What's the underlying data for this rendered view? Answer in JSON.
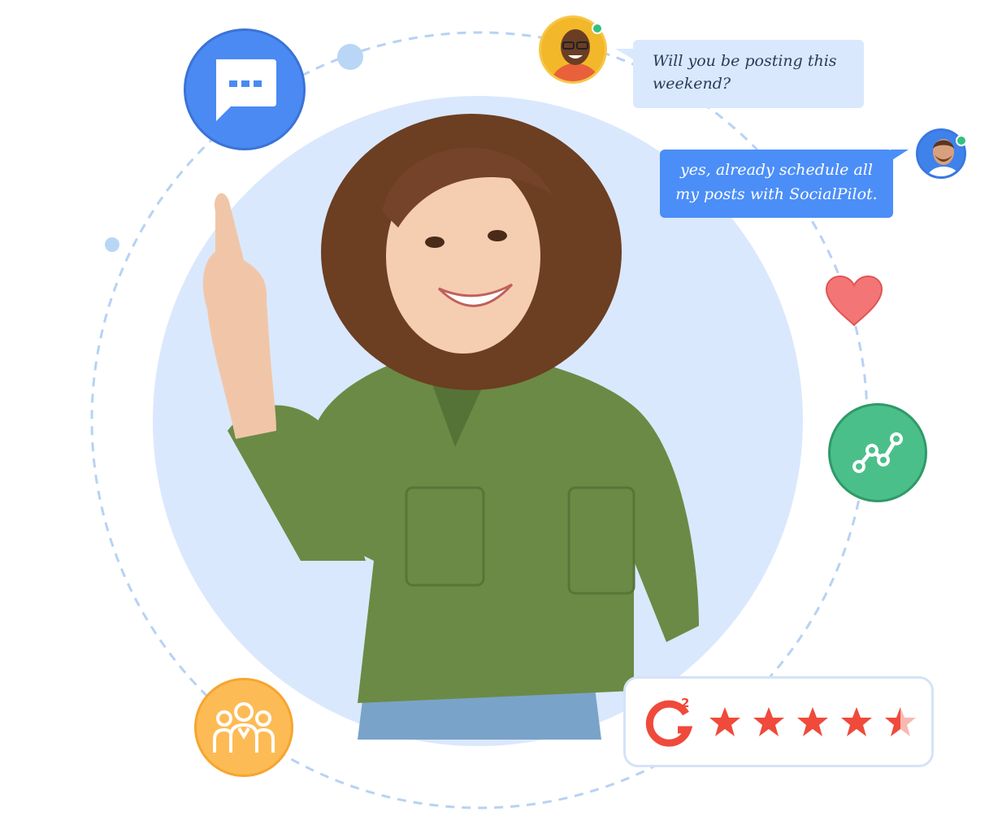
{
  "chat": {
    "question": "Will you be posting this weekend?",
    "reply": "yes, already schedule all my posts with SocialPilot."
  },
  "rating": {
    "brand": "G2",
    "stars_value": 4.5,
    "stars_max": 5,
    "star_color": "#ef4a3b"
  },
  "icons": {
    "chat": "chat-bubble-icon",
    "analytics": "trend-line-icon",
    "like": "heart-icon",
    "team": "team-icon"
  },
  "colors": {
    "chat_circle": "#4a8af2",
    "analytics_circle": "#4bbf8a",
    "team_circle": "#fdbb55",
    "heart": "#f26c6c",
    "reply_bubble": "#4b8ef7",
    "question_bubble": "#dae8fd"
  }
}
